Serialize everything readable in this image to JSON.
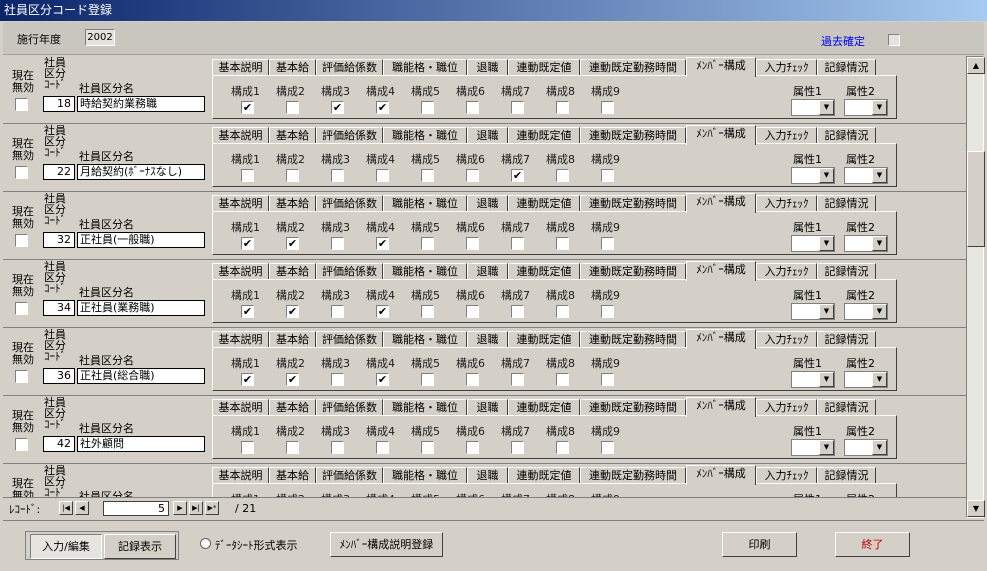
{
  "window": {
    "title": "社員区分コード登録"
  },
  "header": {
    "year_label": "施行年度",
    "year_value": "2002",
    "kako_label": "過去確定",
    "kako_checked": false
  },
  "row_labels": {
    "genzai": "現在",
    "mukou": "無効",
    "code1": "社員",
    "code2": "区分",
    "code3": "ｺｰﾄﾞ",
    "name": "社員区分名"
  },
  "tabs": [
    "基本説明",
    "基本給",
    "評価給係数",
    "職能格・職位",
    "退職",
    "連動既定値",
    "連動既定勤務時間",
    "ﾒﾝﾊﾞｰ構成",
    "入力ﾁｪｯｸ",
    "記録情況"
  ],
  "active_tab_index": 7,
  "kosei_labels": [
    "構成1",
    "構成2",
    "構成3",
    "構成4",
    "構成5",
    "構成6",
    "構成7",
    "構成8",
    "構成9"
  ],
  "zokusei_labels": [
    "属性1",
    "属性2"
  ],
  "records": [
    {
      "code": "18",
      "name": "時給契約業務職",
      "checks": [
        true,
        false,
        true,
        true,
        false,
        false,
        false,
        false,
        false
      ]
    },
    {
      "code": "22",
      "name": "月給契約(ﾎﾞｰﾅｽなし)",
      "checks": [
        false,
        false,
        false,
        false,
        false,
        false,
        true,
        false,
        false
      ]
    },
    {
      "code": "32",
      "name": "正社員(一般職)",
      "checks": [
        true,
        true,
        false,
        true,
        false,
        false,
        false,
        false,
        false
      ]
    },
    {
      "code": "34",
      "name": "正社員(業務職)",
      "checks": [
        true,
        true,
        false,
        true,
        false,
        false,
        false,
        false,
        false
      ]
    },
    {
      "code": "36",
      "name": "正社員(総合職)",
      "checks": [
        true,
        true,
        false,
        true,
        false,
        false,
        false,
        false,
        false
      ]
    },
    {
      "code": "42",
      "name": "社外顧問",
      "checks": [
        false,
        false,
        false,
        false,
        false,
        false,
        false,
        false,
        false
      ]
    },
    {
      "code": "",
      "name": "",
      "checks": [
        false,
        false,
        false,
        false,
        false,
        false,
        false,
        false,
        false
      ]
    }
  ],
  "navigator": {
    "label": "ﾚｺｰﾄﾞ:",
    "current": "5",
    "total": "/ 21"
  },
  "footer": {
    "input_edit": "入力/編集",
    "record_view": "記録表示",
    "datasheet": "ﾃﾞｰﾀｼｰﾄ形式表示",
    "member_desc": "ﾒﾝﾊﾞｰ構成説明登録",
    "print": "印刷",
    "exit": "終了",
    "exit_color": "#c00000"
  }
}
